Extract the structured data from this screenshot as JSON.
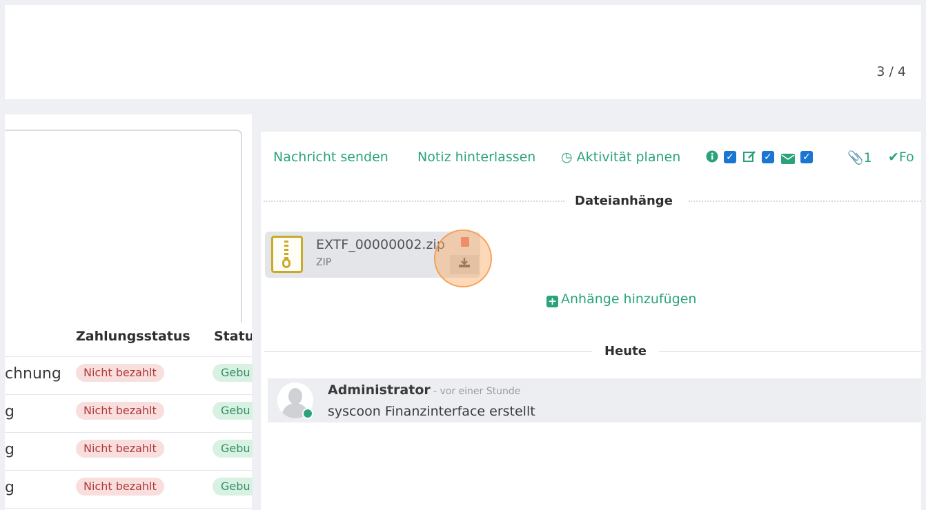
{
  "pager": "3 / 4",
  "table": {
    "columns": [
      "Zahlungsstatus",
      "Statu"
    ],
    "rows": [
      {
        "name": "chnung",
        "payment": "Nicht bezahlt",
        "status": "Gebu"
      },
      {
        "name": "g",
        "payment": "Nicht bezahlt",
        "status": "Gebu"
      },
      {
        "name": "g",
        "payment": "Nicht bezahlt",
        "status": "Gebu"
      },
      {
        "name": "g",
        "payment": "Nicht bezahlt",
        "status": "Gebu"
      }
    ]
  },
  "chatter": {
    "send_message": "Nachricht senden",
    "log_note": "Notiz hinterlassen",
    "plan_activity": "Aktivität planen",
    "attachment_count": "1",
    "follow": "Fo",
    "attachments_title": "Dateianhänge",
    "attachment": {
      "name": "EXTF_00000002.zip",
      "type": "ZIP"
    },
    "add_attachments": "Anhänge hinzufügen",
    "today_title": "Heute",
    "message": {
      "author": "Administrator",
      "time": "- vor einer Stunde",
      "body": "syscoon Finanzinterface erstellt"
    }
  },
  "icons": {
    "activity": "clock-icon",
    "info": "info-icon",
    "edit": "edit-icon",
    "mail": "envelope-icon",
    "paperclip": "paperclip-icon",
    "check": "check-icon",
    "trash": "trash-icon",
    "download": "download-icon"
  },
  "colors": {
    "accent": "#2aa37d",
    "checkbox": "#1976d2",
    "badge_red_bg": "#f9dede",
    "badge_green_bg": "#d9f1e3",
    "highlight": "#f5a25a"
  }
}
